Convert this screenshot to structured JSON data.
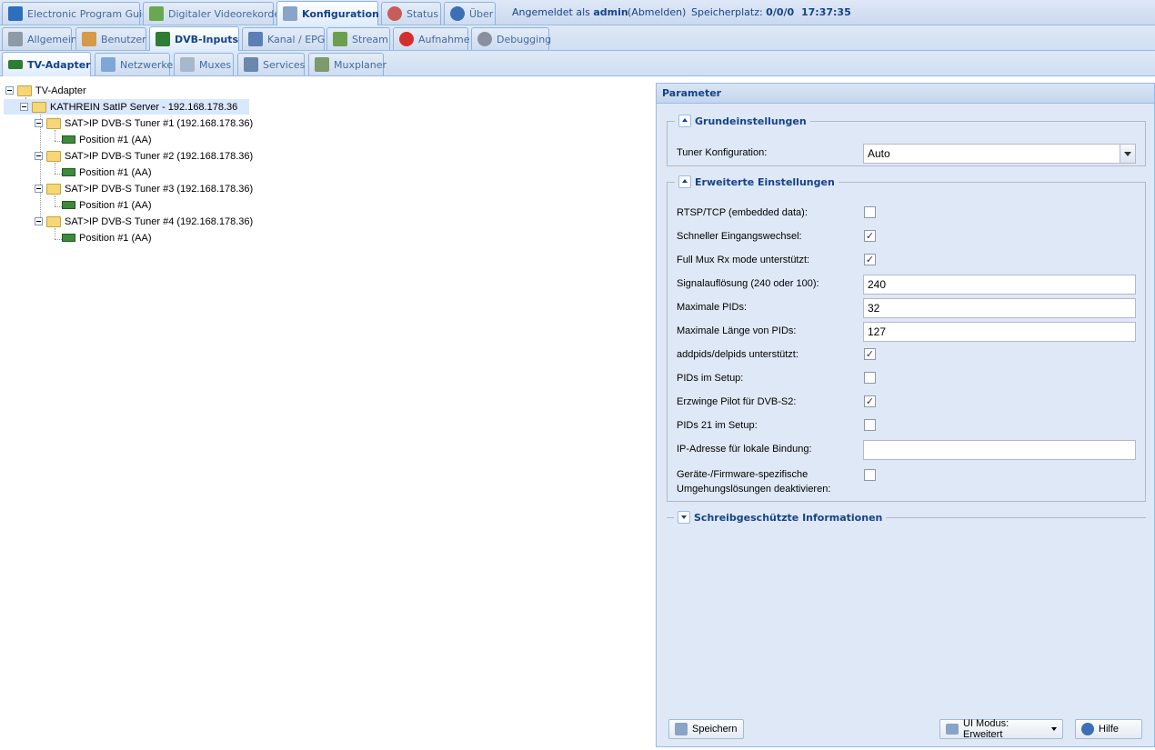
{
  "top_tabs": [
    {
      "label": "Electronic Program Guide",
      "icon": "epg-icon"
    },
    {
      "label": "Digitaler Videorekorder",
      "icon": "download-icon"
    },
    {
      "label": "Konfiguration",
      "icon": "wrench-icon"
    },
    {
      "label": "Status",
      "icon": "eye-icon"
    },
    {
      "label": "Über",
      "icon": "info-icon"
    }
  ],
  "status": {
    "logged_prefix": "Angemeldet als",
    "user": "admin",
    "logout": "(Abmelden)",
    "space_prefix": "Speicherplatz:",
    "space": "0/0/0",
    "time": "17:37:35"
  },
  "second_tabs": [
    {
      "label": "Allgemein",
      "icon": "tools-icon"
    },
    {
      "label": "Benutzer",
      "icon": "users-icon"
    },
    {
      "label": "DVB-Inputs",
      "icon": "tv-card-icon"
    },
    {
      "label": "Kanal / EPG",
      "icon": "tv-icon"
    },
    {
      "label": "Stream",
      "icon": "stream-icon"
    },
    {
      "label": "Aufnahme",
      "icon": "rec-icon"
    },
    {
      "label": "Debugging",
      "icon": "debug-icon"
    }
  ],
  "third_tabs": [
    {
      "label": "TV-Adapter",
      "icon": "tv-adapter-icon"
    },
    {
      "label": "Netzwerke",
      "icon": "antenna-icon"
    },
    {
      "label": "Muxes",
      "icon": "satellite-icon"
    },
    {
      "label": "Services",
      "icon": "services-icon"
    },
    {
      "label": "Muxplaner",
      "icon": "calendar-check-icon"
    }
  ],
  "tree": {
    "root": "TV-Adapter",
    "server": "KATHREIN SatIP Server - 192.168.178.36",
    "tuners": [
      {
        "label": "SAT>IP DVB-S Tuner #1 (192.168.178.36)",
        "position": "Position #1 (AA)"
      },
      {
        "label": "SAT>IP DVB-S Tuner #2 (192.168.178.36)",
        "position": "Position #1 (AA)"
      },
      {
        "label": "SAT>IP DVB-S Tuner #3 (192.168.178.36)",
        "position": "Position #1 (AA)"
      },
      {
        "label": "SAT>IP DVB-S Tuner #4 (192.168.178.36)",
        "position": "Position #1 (AA)"
      }
    ]
  },
  "panel": {
    "title": "Parameter",
    "basic": {
      "legend": "Grundeinstellungen",
      "tuner_label": "Tuner Konfiguration:",
      "tuner_value": "Auto"
    },
    "advanced": {
      "legend": "Erweiterte Einstellungen",
      "fields": [
        {
          "label": "RTSP/TCP (embedded data):",
          "type": "checkbox",
          "checked": false
        },
        {
          "label": "Schneller Eingangswechsel:",
          "type": "checkbox",
          "checked": true
        },
        {
          "label": "Full Mux Rx mode unterstützt:",
          "type": "checkbox",
          "checked": true
        },
        {
          "label": "Signalauflösung (240 oder 100):",
          "type": "text",
          "value": "240"
        },
        {
          "label": "Maximale PIDs:",
          "type": "text",
          "value": "32"
        },
        {
          "label": "Maximale Länge von PIDs:",
          "type": "text",
          "value": "127"
        },
        {
          "label": "addpids/delpids unterstützt:",
          "type": "checkbox",
          "checked": true
        },
        {
          "label": "PIDs im Setup:",
          "type": "checkbox",
          "checked": false
        },
        {
          "label": "Erzwinge Pilot für DVB-S2:",
          "type": "checkbox",
          "checked": true
        },
        {
          "label": "PIDs 21 im Setup:",
          "type": "checkbox",
          "checked": false
        },
        {
          "label": "IP-Adresse für lokale Bindung:",
          "type": "text",
          "value": ""
        }
      ],
      "last_label_line1": "Geräte-/Firmware-spezifische",
      "last_label_line2": "Umgehungslösungen deaktivieren:",
      "last_checked": false
    },
    "readonly_legend": "Schreibgeschützte Informationen",
    "buttons": {
      "save": "Speichern",
      "ui_mode": "UI Modus: Erweitert",
      "help": "Hilfe"
    }
  }
}
